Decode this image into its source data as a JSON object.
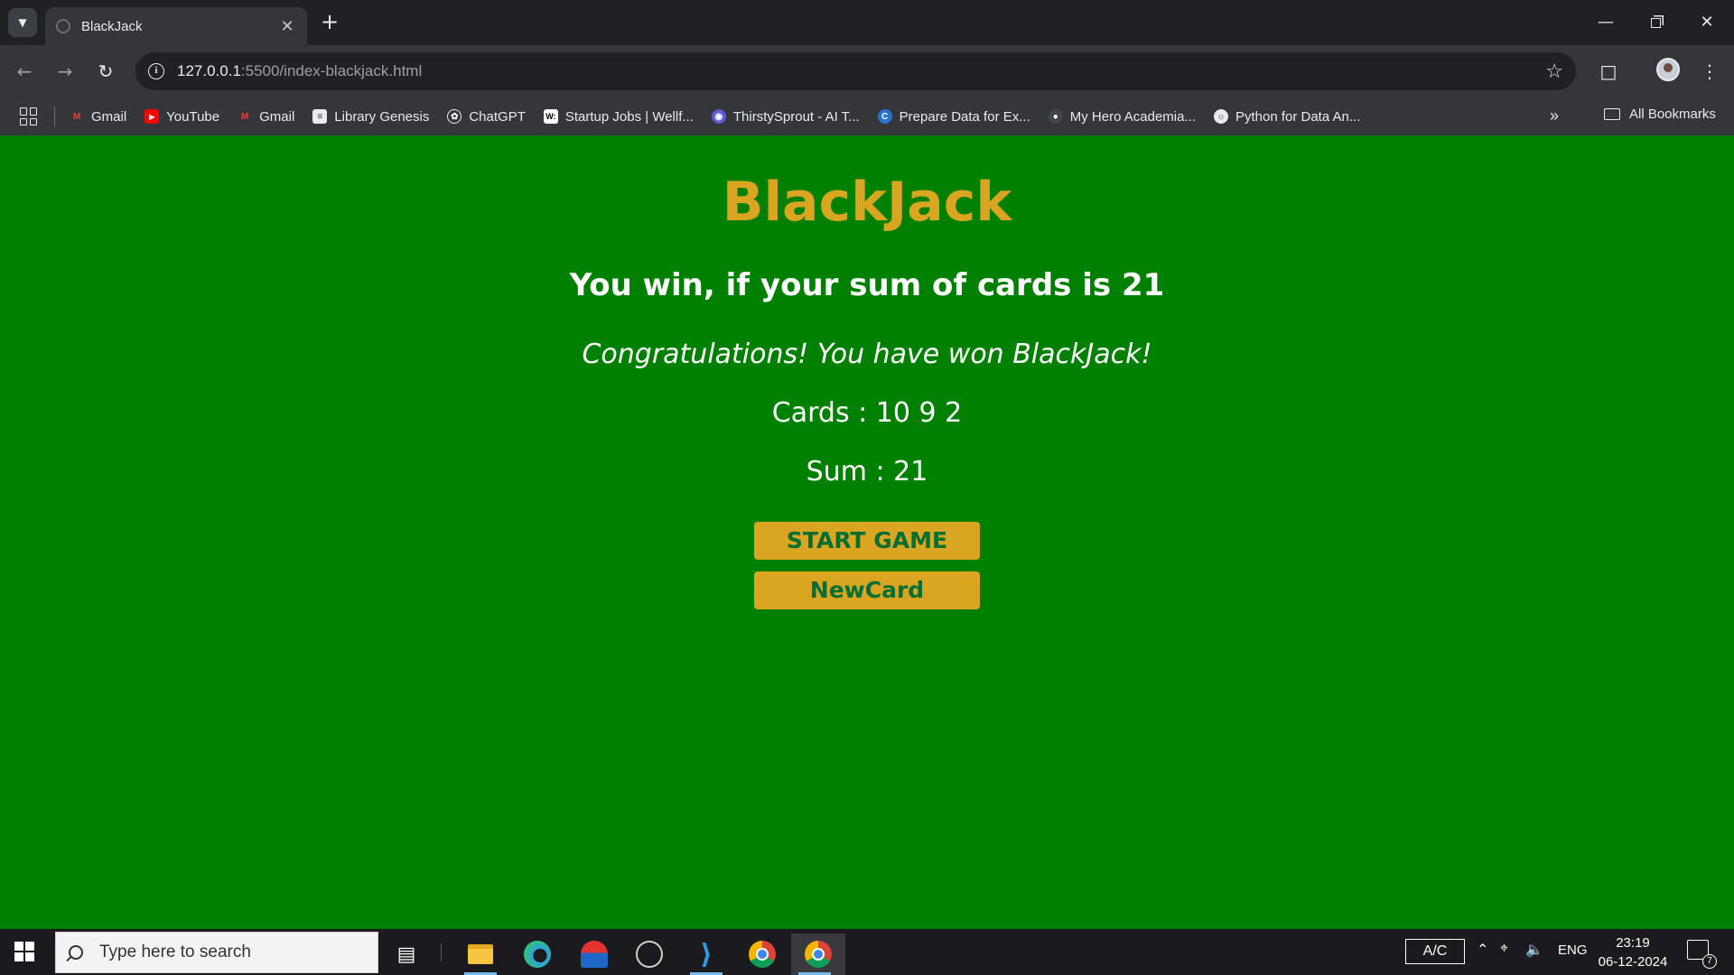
{
  "browser": {
    "tab_title": "BlackJack",
    "url_host": "127.0.0.1",
    "url_rest": ":5500/index-blackjack.html",
    "bookmarks": [
      {
        "label": "Gmail",
        "icon": "gmail-icon",
        "color": "#ea4335"
      },
      {
        "label": "YouTube",
        "icon": "youtube-icon",
        "color": "#ff0000"
      },
      {
        "label": "Gmail",
        "icon": "gmail-icon",
        "color": "#ea4335"
      },
      {
        "label": "Library Genesis",
        "icon": "library-genesis-icon",
        "color": "#e8eaed"
      },
      {
        "label": "ChatGPT",
        "icon": "chatgpt-icon",
        "color": "#e8eaed"
      },
      {
        "label": "Startup Jobs | Wellf...",
        "icon": "wellfound-icon",
        "color": "#ffffff"
      },
      {
        "label": "ThirstySprout - AI T...",
        "icon": "thirstysprout-icon",
        "color": "#5b5bd6"
      },
      {
        "label": "Prepare Data for Ex...",
        "icon": "coursera-icon",
        "color": "#2a73cc"
      },
      {
        "label": "My Hero Academia...",
        "icon": "anime-icon",
        "color": "#444444"
      },
      {
        "label": "Python for Data An...",
        "icon": "globe-icon",
        "color": "#e8eaed"
      }
    ],
    "all_bookmarks": "All Bookmarks"
  },
  "game": {
    "title": "BlackJack",
    "rule": "You win, if your sum of cards is 21",
    "message": "Congratulations! You have won BlackJack!",
    "cards_text": "Cards : 10 9 2",
    "sum_text": "Sum : 21",
    "start_button": "START GAME",
    "newcard_button": "NewCard",
    "colors": {
      "background": "#008000",
      "title": "#daa520",
      "button": "#daa520",
      "button_text": "#016f32"
    }
  },
  "taskbar": {
    "search_placeholder": "Type here to search",
    "battery_label": "A/C",
    "language": "ENG",
    "time": "23:19",
    "date": "06-12-2024",
    "notification_count": "7"
  }
}
